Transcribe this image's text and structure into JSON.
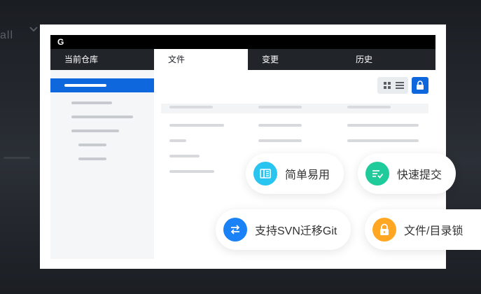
{
  "background": {
    "left_text": "all"
  },
  "window": {
    "logo": "G",
    "tabs": [
      {
        "label": "当前仓库"
      },
      {
        "label": "文件"
      },
      {
        "label": "变更"
      },
      {
        "label": "历史"
      }
    ]
  },
  "features": [
    {
      "label": "简单易用",
      "icon": "book-icon",
      "color": "#29c4ef"
    },
    {
      "label": "快速提交",
      "icon": "checklist-icon",
      "color": "#1fcb9b"
    },
    {
      "label": "支持SVN迁移Git",
      "icon": "swap-icon",
      "color": "#1a82f6"
    },
    {
      "label": "文件/目录锁",
      "icon": "lock-icon",
      "color": "#ffa623"
    }
  ],
  "colors": {
    "accent": "#0e67dd",
    "titlebar": "#000000",
    "tabbar": "#212429"
  }
}
